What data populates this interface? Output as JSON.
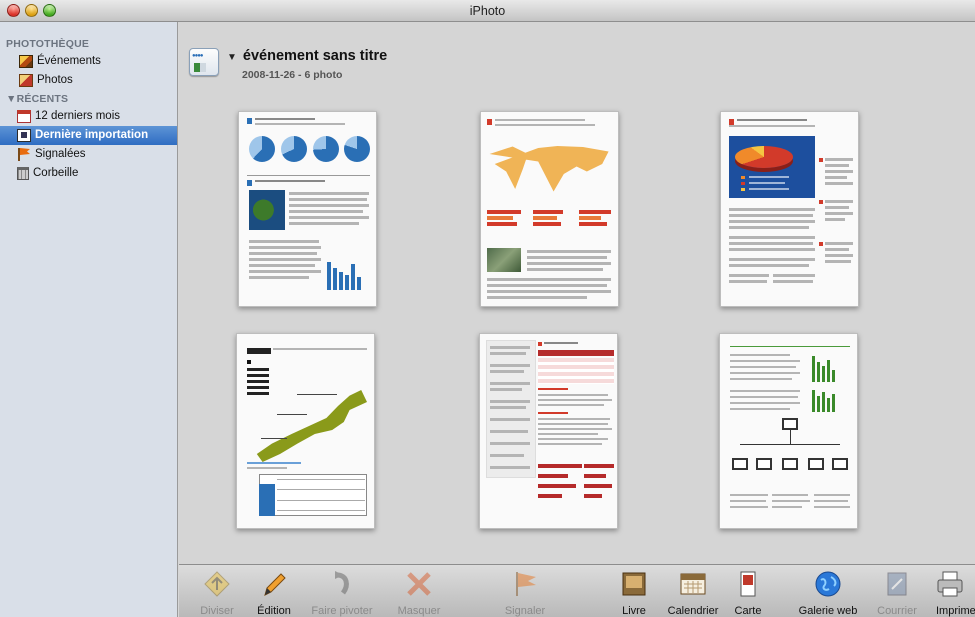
{
  "window": {
    "title": "iPhoto"
  },
  "sidebar": {
    "library_header": "PHOTOTHÈQUE",
    "library_items": [
      {
        "label": "Événements",
        "icon": "events-icon"
      },
      {
        "label": "Photos",
        "icon": "photos-icon"
      }
    ],
    "recent_header": "▼RÉCENTS",
    "recent_items": [
      {
        "label": "12 derniers mois",
        "icon": "calendar-icon"
      },
      {
        "label": "Dernière importation",
        "icon": "last-import-icon",
        "selected": true
      },
      {
        "label": "Signalées",
        "icon": "flag-icon"
      },
      {
        "label": "Corbeille",
        "icon": "trash-icon"
      }
    ]
  },
  "event": {
    "title": "événement sans titre",
    "disclosure": "▼",
    "subtitle": "2008-11-26 - 6 photo"
  },
  "photos": [
    {
      "name": "document-pie-charts"
    },
    {
      "name": "document-world-map"
    },
    {
      "name": "document-3d-pie"
    },
    {
      "name": "document-japan-map"
    },
    {
      "name": "document-tables"
    },
    {
      "name": "document-network"
    }
  ],
  "toolbar": {
    "buttons": [
      {
        "label": "Diviser",
        "icon": "split-icon",
        "enabled": false
      },
      {
        "label": "Édition",
        "icon": "pencil-icon",
        "enabled": true
      },
      {
        "label": "Faire pivoter",
        "icon": "rotate-icon",
        "enabled": false
      },
      {
        "label": "Masquer",
        "icon": "hide-x-icon",
        "enabled": false
      },
      {
        "label": "Signaler",
        "icon": "flag-icon",
        "enabled": false
      },
      {
        "label": "Livre",
        "icon": "book-icon",
        "enabled": true
      },
      {
        "label": "Calendrier",
        "icon": "calendar-icon",
        "enabled": true
      },
      {
        "label": "Carte",
        "icon": "card-icon",
        "enabled": true
      },
      {
        "label": "Galerie web",
        "icon": "globe-icon",
        "enabled": true
      },
      {
        "label": "Courrier",
        "icon": "mail-icon",
        "enabled": false
      },
      {
        "label": "Imprimer",
        "icon": "printer-icon",
        "enabled": true
      }
    ]
  },
  "colors": {
    "selection": "#3873c4",
    "sidebar_bg": "#d9dfe8",
    "content_bg": "#d5d5d5",
    "disabled_text": "#8a8a8a"
  }
}
